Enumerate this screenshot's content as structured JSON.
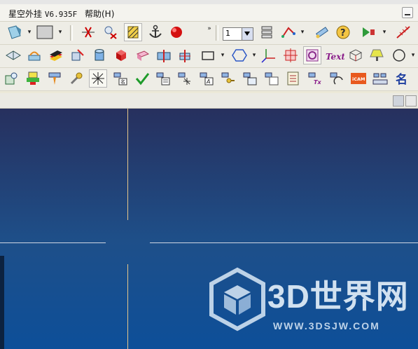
{
  "menubar": {
    "app_name": "星空外挂",
    "version": "V6.935F",
    "help": "帮助(H)"
  },
  "toolbar": {
    "layer_value": "1",
    "text_tool_label": "Text",
    "icam_label": "iCAM",
    "name_label": "名"
  },
  "watermark": {
    "brand": "3D世界网",
    "url": "WWW.3DSJW.COM"
  },
  "colors": {
    "viewport_top": "#27305e",
    "viewport_bottom": "#0d4f99",
    "crosshair_vertical": "#e5c68a",
    "crosshair_horizontal": "#cfd5e2"
  }
}
